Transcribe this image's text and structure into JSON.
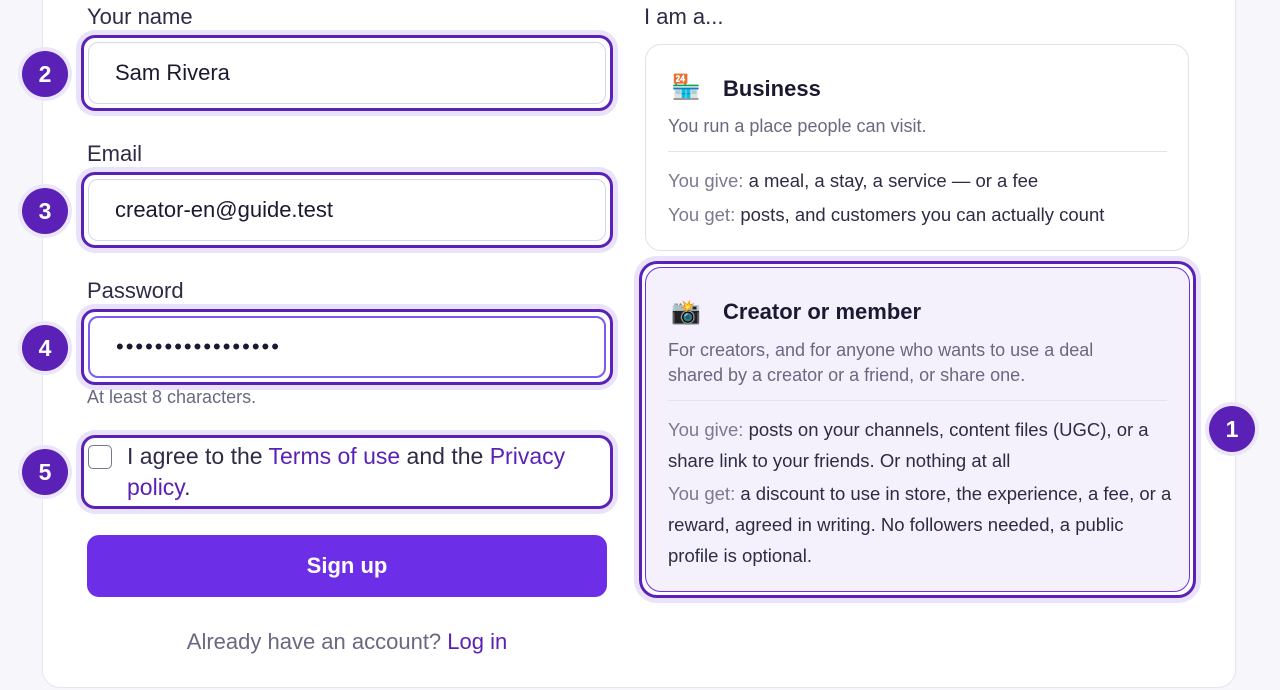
{
  "form": {
    "name_label": "Your name",
    "name_value": "Sam Rivera",
    "email_label": "Email",
    "email_value": "creator-en@guide.test",
    "password_label": "Password",
    "password_value": "•••••••••••••••••",
    "password_hint": "At least 8 characters.",
    "terms_prefix": "I agree to the ",
    "terms_link": "Terms of use",
    "terms_middle": " and the ",
    "privacy_link": "Privacy policy",
    "terms_suffix": ".",
    "signup_label": "Sign up",
    "login_prompt": "Already have an account? ",
    "login_link": "Log in"
  },
  "roles": {
    "heading": "I am a...",
    "business": {
      "icon": "🏪",
      "title": "Business",
      "desc": "You run a place people can visit.",
      "give_label": "You give:",
      "give_text": " a meal, a stay, a service — or a fee",
      "get_label": "You get:",
      "get_text": " posts, and customers you can actually count"
    },
    "creator": {
      "icon": "📸",
      "title": "Creator or member",
      "desc": "For creators, and for anyone who wants to use a deal shared by a creator or a friend, or share one.",
      "give_label": "You give:",
      "give_text": " posts on your channels, content files (UGC), or a share link to your friends. Or nothing at all",
      "get_label": "You get:",
      "get_text": " a discount to use in store, the experience, a fee, or a reward, agreed in writing. No followers needed, a public profile is optional."
    }
  },
  "badges": [
    "1",
    "2",
    "3",
    "4",
    "5"
  ],
  "colors": {
    "accent": "#6d2ee8",
    "highlight": "#5b21b6",
    "selected_bg": "#f4f1fd"
  }
}
